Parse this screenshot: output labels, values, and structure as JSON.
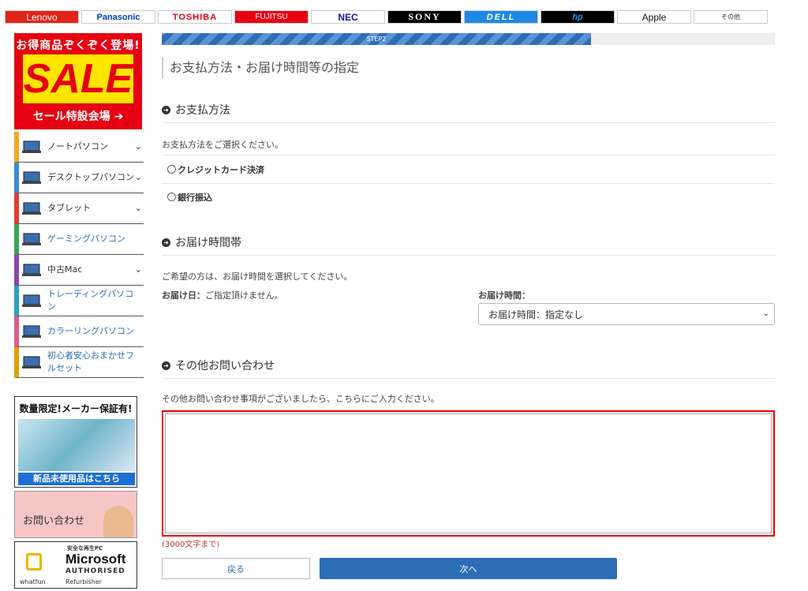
{
  "brands": [
    {
      "label": "Lenovo",
      "cls": "b-lenovo"
    },
    {
      "label": "Panasonic",
      "cls": "b-panasonic"
    },
    {
      "label": "TOSHIBA",
      "cls": "b-toshiba"
    },
    {
      "label": "FUJITSU",
      "cls": "b-fujitsu"
    },
    {
      "label": "NEC",
      "cls": "b-nec"
    },
    {
      "label": "SONY",
      "cls": "b-sony"
    },
    {
      "label": "DELL",
      "cls": "b-dell"
    },
    {
      "label": "hp",
      "cls": "b-hp"
    },
    {
      "label": " Apple",
      "cls": "b-apple"
    },
    {
      "label": "その他",
      "cls": "b-other"
    }
  ],
  "sidebar": {
    "sale": {
      "line1": "お得商品ぞくぞく登場!",
      "big": "SALE",
      "line2": "セール特設会場"
    },
    "items": [
      {
        "label": "ノートパソコン",
        "color": "c-orange",
        "chevron": true,
        "icon": "laptop-icon"
      },
      {
        "label": "デスクトップパソコン",
        "color": "c-blue",
        "chevron": true,
        "icon": "desktop-icon"
      },
      {
        "label": "タブレット",
        "color": "c-red",
        "chevron": true,
        "icon": "tablet-icon"
      },
      {
        "label": "ゲーミングパソコン",
        "color": "c-green",
        "chevron": false,
        "icon": "gaming-icon",
        "blue": true
      },
      {
        "label": "中古Mac",
        "color": "c-purple",
        "chevron": true,
        "icon": "mac-icon"
      },
      {
        "label": "トレーディングパソコン",
        "color": "c-teal",
        "chevron": false,
        "icon": "trading-icon",
        "blue": true
      },
      {
        "label": "カラーリングパソコン",
        "color": "c-pink",
        "chevron": false,
        "icon": "color-icon",
        "blue": true
      },
      {
        "label": "初心者安心おまかせフルセット",
        "color": "c-gold",
        "chevron": false,
        "icon": "beginner-icon",
        "blue": true
      }
    ],
    "promo": {
      "title": "数量限定!メーカー保証有!",
      "bar": "新品未使用品はこちら"
    },
    "contact": "お問い合わせ",
    "ms": {
      "small": "安全な再生PC",
      "brand": "Microsoft",
      "auth": "AUTHORISED",
      "refurb": "Refurbisher",
      "whatfun": "whatfun"
    }
  },
  "progress": {
    "label": "STEP2",
    "fraction": 0.7
  },
  "main": {
    "title": "お支払方法・お届け時間等の指定",
    "payment": {
      "heading": "お支払方法",
      "instruction": "お支払方法をご選択ください。",
      "options": [
        "クレジットカード決済",
        "銀行振込"
      ]
    },
    "delivery": {
      "heading": "お届け時間帯",
      "instruction": "ご希望の方は、お届け時間を選択してください。",
      "date_label": "お届け日：",
      "date_value": "ご指定頂けません。",
      "time_label": "お届け時間：",
      "time_value": "お届け時間：指定なし"
    },
    "inquiry": {
      "heading": "その他お問い合わせ",
      "instruction": "その他お問い合わせ事項がございましたら、こちらにご入力ください。",
      "limit": "(3000文字まで)"
    },
    "buttons": {
      "back": "戻る",
      "next": "次へ"
    }
  }
}
